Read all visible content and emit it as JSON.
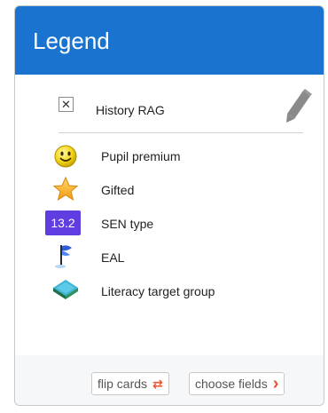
{
  "legend": {
    "title": "Legend",
    "filter": {
      "remove_symbol": "✕",
      "label": "History RAG"
    },
    "items": [
      {
        "icon": "smiley-icon",
        "label": "Pupil premium"
      },
      {
        "icon": "star-icon",
        "label": "Gifted"
      },
      {
        "icon": "sen-badge",
        "badge_text": "13.2",
        "label": "SEN type"
      },
      {
        "icon": "flag-icon",
        "label": "EAL"
      },
      {
        "icon": "book-icon",
        "label": "Literacy target group"
      }
    ],
    "footer": {
      "flip_label": "flip cards",
      "flip_icon": "⇄",
      "choose_label": "choose fields",
      "choose_icon": "›"
    }
  },
  "colors": {
    "header": "#1a73cf",
    "sen_badge": "#5f3de0",
    "button_icon": "#e8532b"
  }
}
